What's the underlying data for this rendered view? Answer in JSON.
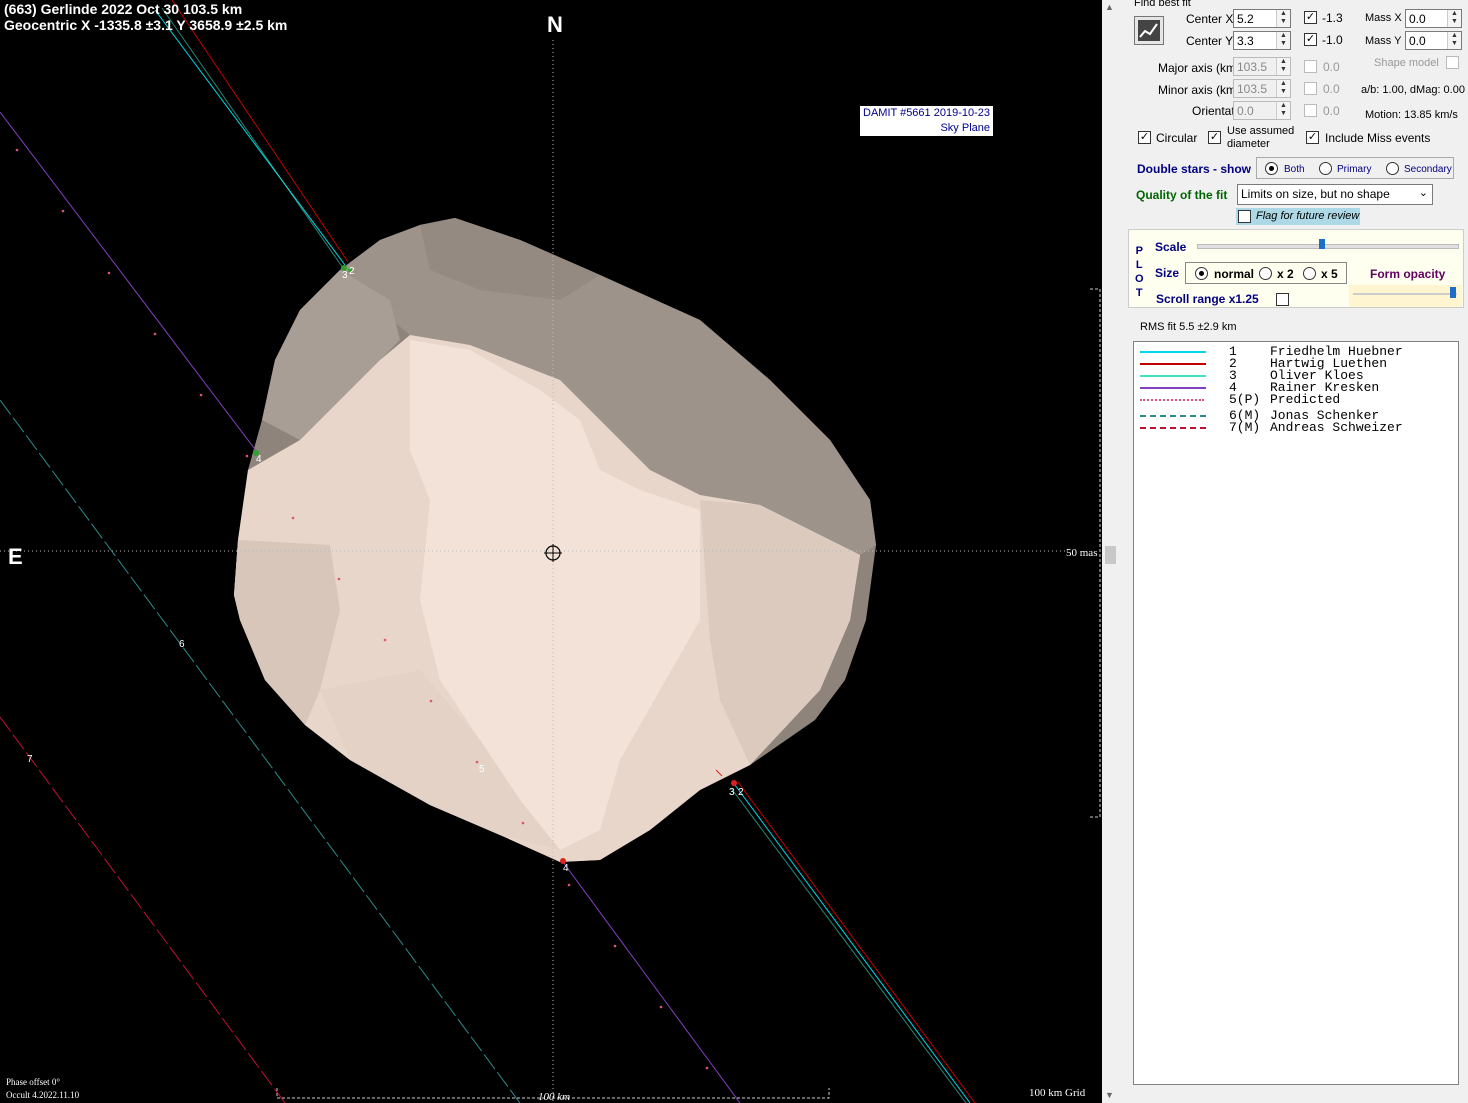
{
  "plot": {
    "header_line1": "(663) Gerlinde  2022 Oct 30   103.5 km",
    "header_line2": "Geocentric  X  -1335.8 ±3.1  Y 3658.9 ±2.5 km",
    "north_label": "N",
    "east_label": "E",
    "damit_line1": "DAMIT #5661 2019-10-23",
    "damit_line2": "Sky Plane",
    "scale_mas": "50 mas",
    "scale_km": "100 km",
    "grid_label": "100 km Grid",
    "phase_offset": "Phase offset 0°",
    "version": "Occult 4.2022.11.10",
    "chord_labels": [
      "1",
      "2",
      "3",
      "4",
      "5",
      "6",
      "7"
    ]
  },
  "panel": {
    "find_best_fit": "Find best fit",
    "center_x_label": "Center X",
    "center_x_value": "5.2",
    "center_x_check": "-1.3",
    "center_y_label": "Center Y",
    "center_y_value": "3.3",
    "center_y_check": "-1.0",
    "mass_x_label": "Mass X",
    "mass_x_value": "0.0",
    "mass_y_label": "Mass Y",
    "mass_y_value": "0.0",
    "shape_model_label": "Shape model",
    "major_axis_label": "Major axis (km)",
    "major_axis_value": "103.5",
    "major_axis_check": "0.0",
    "minor_axis_label": "Minor axis (km)",
    "minor_axis_value": "103.5",
    "minor_axis_check": "0.0",
    "orientation_label": "Orientation",
    "orientation_value": "0.0",
    "orientation_check": "0.0",
    "ab_dmag": "a/b: 1.00, dMag: 0.00",
    "motion": "Motion: 13.85 km/s",
    "circular_label": "Circular",
    "use_assumed_l1": "Use assumed",
    "use_assumed_l2": "diameter",
    "include_miss_label": "Include Miss events",
    "double_stars_label": "Double stars - show",
    "ds_both": "Both",
    "ds_primary": "Primary",
    "ds_secondary": "Secondary",
    "quality_label": "Quality of the fit",
    "quality_value": "Limits on size, but no shape",
    "flag_review": "Flag for future review",
    "plot_vertical": [
      "P",
      "L",
      "O",
      "T"
    ],
    "scale_label": "Scale",
    "size_label": "Size",
    "size_normal": "normal",
    "size_x2": "x 2",
    "size_x5": "x 5",
    "form_opacity": "Form opacity",
    "scroll_range": "Scroll range x1.25",
    "rms_fit": "RMS fit 5.5 ±2.9 km",
    "scale_level": 0.48,
    "opacity_level": 0.97
  },
  "legend": [
    {
      "num": "1",
      "name": "Friedhelm Huebner",
      "color": "#00d8e8",
      "style": "solid"
    },
    {
      "num": "2",
      "name": "Hartwig Luethen",
      "color": "#c00000",
      "style": "solid"
    },
    {
      "num": "3",
      "name": "Oliver Kloes",
      "color": "#40e0c0",
      "style": "solid"
    },
    {
      "num": "4",
      "name": "Rainer Kresken",
      "color": "#8040c0",
      "style": "solid"
    },
    {
      "num": "5(P)",
      "name": "Predicted",
      "color": "#e05080",
      "style": "dotted"
    },
    {
      "num": "6(M)",
      "name": "Jonas Schenker",
      "color": "#2e8b8b",
      "style": "dashed"
    },
    {
      "num": "7(M)",
      "name": "Andreas Schweizer",
      "color": "#c01030",
      "style": "dashed"
    }
  ]
}
